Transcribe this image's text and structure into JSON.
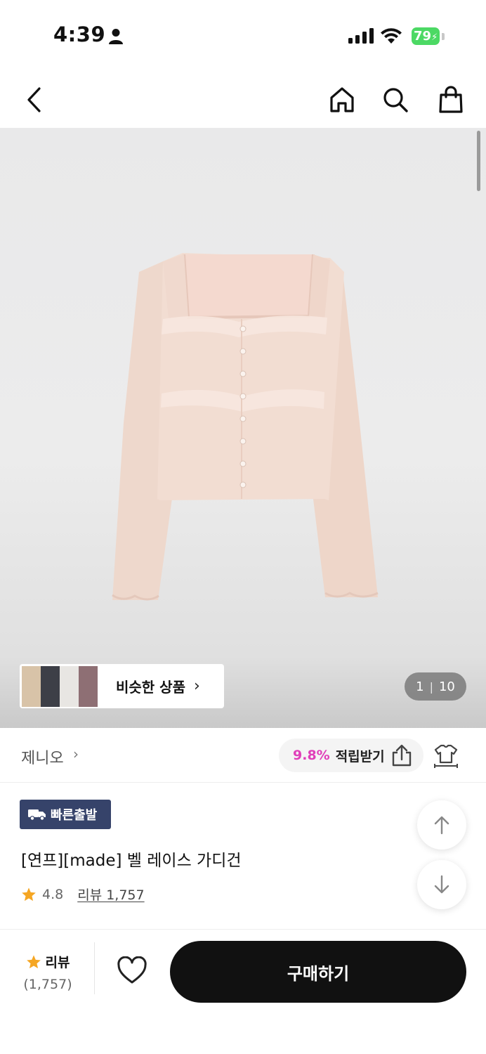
{
  "status_bar": {
    "time": "4:39",
    "battery": "79"
  },
  "nav": {
    "back_icon": "chevron-left-icon",
    "home_icon": "home-icon",
    "search_icon": "search-icon",
    "cart_icon": "shopping-bag-icon"
  },
  "hero": {
    "similar_label": "비슷한 상품",
    "pager_current": "1",
    "pager_total": "10"
  },
  "seller": {
    "brand": "제니오",
    "reward_percent": "9.8%",
    "reward_label": "적립받기"
  },
  "product": {
    "badge": "빠른출발",
    "title": "[연프][made] 벨 레이스 가디건",
    "rating": "4.8",
    "review_link": "리뷰 1,757"
  },
  "bottom": {
    "review_label": "리뷰",
    "review_count": "(1,757)",
    "buy_label": "구매하기"
  },
  "colors": {
    "accent_pink": "#e03fb9",
    "badge_navy": "#36436a",
    "star": "#f5a623",
    "battery_green": "#4cd964"
  }
}
